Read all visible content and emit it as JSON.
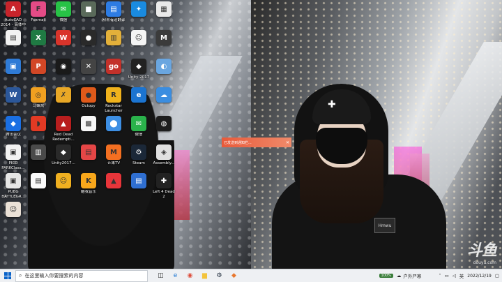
{
  "desktop_icons": [
    {
      "label": "AutoCAD 2014 - 简体中文",
      "glyph": "A",
      "color": "#c8242b"
    },
    {
      "label": "Foxmail",
      "glyph": "F",
      "color": "#e44b86"
    },
    {
      "label": "微信",
      "glyph": "✉",
      "color": "#27c246"
    },
    {
      "label": "",
      "glyph": "■",
      "color": "#5a6a5a"
    },
    {
      "label": "网易有道翻译",
      "glyph": "▤",
      "color": "#2d7ce4"
    },
    {
      "label": "",
      "glyph": "✦",
      "color": "#1a8be0"
    },
    {
      "label": "",
      "glyph": "▦",
      "color": "#e9e9e9"
    },
    {
      "label": "",
      "glyph": "▤",
      "color": "#f1f1f1"
    },
    {
      "label": "",
      "glyph": "X",
      "color": "#1f7a43"
    },
    {
      "label": "",
      "glyph": "W",
      "color": "#d9342b"
    },
    {
      "label": "",
      "glyph": "●",
      "color": "#2a2a2a"
    },
    {
      "label": "",
      "glyph": "▥",
      "color": "#e3b03a"
    },
    {
      "label": "",
      "glyph": "☺",
      "color": "#f4f4f4"
    },
    {
      "label": "",
      "glyph": "M",
      "color": "#3b3b3b"
    },
    {
      "label": "",
      "glyph": "▣",
      "color": "#2f7bd6"
    },
    {
      "label": "",
      "glyph": "P",
      "color": "#d24726"
    },
    {
      "label": "",
      "glyph": "◉",
      "color": "#1a1a1a"
    },
    {
      "label": "",
      "glyph": "✕",
      "color": "#444"
    },
    {
      "label": "",
      "glyph": "go",
      "color": "#c3312a"
    },
    {
      "label": "Unity 2017",
      "glyph": "◆",
      "color": "#222"
    },
    {
      "label": "",
      "glyph": "◐",
      "color": "#6aa6e0"
    },
    {
      "label": "",
      "glyph": "W",
      "color": "#2b579a"
    },
    {
      "label": "马蜂窝",
      "glyph": "◎",
      "color": "#f0a020"
    },
    {
      "label": "",
      "glyph": "✗",
      "color": "#e9a826"
    },
    {
      "label": "Octopy",
      "glyph": "●",
      "color": "#e05a1a"
    },
    {
      "label": "Rockstar Launcher",
      "glyph": "R",
      "color": "#f0b21c"
    },
    {
      "label": "",
      "glyph": "e",
      "color": "#1b74d1"
    },
    {
      "label": "",
      "glyph": "☁",
      "color": "#3a8de0"
    },
    {
      "label": "腾讯会议",
      "glyph": "◆",
      "color": "#1a6fe3"
    },
    {
      "label": "",
      "glyph": "◗",
      "color": "#e23a24"
    },
    {
      "label": "Red Dead Redempti...",
      "glyph": "▲",
      "color": "#b81e1e"
    },
    {
      "label": "",
      "glyph": "▩",
      "color": "#f7f7f7"
    },
    {
      "label": "",
      "glyph": "⬤",
      "color": "#3d8fe4"
    },
    {
      "label": "微信",
      "glyph": "✉",
      "color": "#2ab24b"
    },
    {
      "label": "",
      "glyph": "◍",
      "color": "#1d1d1d"
    },
    {
      "label": "PICO PARKClass...",
      "glyph": "▣",
      "color": "#f2f2f2"
    },
    {
      "label": "",
      "glyph": "▥",
      "color": "#4a4a4a"
    },
    {
      "label": "Unity2017...",
      "glyph": "◆",
      "color": "#2a2a2a"
    },
    {
      "label": "",
      "glyph": "▤",
      "color": "#e54646"
    },
    {
      "label": "芒果TV",
      "glyph": "M",
      "color": "#f36f21"
    },
    {
      "label": "Steam",
      "glyph": "⚙",
      "color": "#1b2838"
    },
    {
      "label": "Assembly...",
      "glyph": "◈",
      "color": "#e0e0e0"
    },
    {
      "label": "PUBG BATTLEGR...",
      "glyph": "▣",
      "color": "#e6e6e6"
    },
    {
      "label": "",
      "glyph": "▤",
      "color": "#fafafa"
    },
    {
      "label": "",
      "glyph": "☺",
      "color": "#f0b020"
    },
    {
      "label": "酷我音乐",
      "glyph": "K",
      "color": "#f8a71b"
    },
    {
      "label": "",
      "glyph": "▲",
      "color": "#e8353a"
    },
    {
      "label": "",
      "glyph": "▤",
      "color": "#2f6fd1"
    },
    {
      "label": "Left 4 Dead 2",
      "glyph": "✚",
      "color": "#222"
    },
    {
      "label": "",
      "glyph": "☺",
      "color": "#eae0d6"
    }
  ],
  "overlay_banner": {
    "text": "已发送到通知栏...",
    "close": "✕"
  },
  "photo": {
    "patch_text": "Hmwu",
    "beanie_mark": "✚"
  },
  "watermark": {
    "big": "斗鱼",
    "small": "douyu.com"
  },
  "taskbar": {
    "search_placeholder": "在这里输入你要搜索的内容",
    "apps": [
      {
        "name": "task-view-icon",
        "glyph": "◫",
        "color": "#333"
      },
      {
        "name": "edge-icon",
        "glyph": "e",
        "color": "#1b74d1"
      },
      {
        "name": "chrome-icon",
        "glyph": "◉",
        "color": "#dd4b39"
      },
      {
        "name": "folder-icon",
        "glyph": "▆",
        "color": "#f3c33c"
      },
      {
        "name": "steam-icon",
        "glyph": "⚙",
        "color": "#1b2838"
      },
      {
        "name": "app-icon",
        "glyph": "◆",
        "color": "#e8772e"
      }
    ],
    "pill": "100%",
    "weather": "户外严寒",
    "ime": "英",
    "time": "",
    "date": "2022/12/19"
  }
}
